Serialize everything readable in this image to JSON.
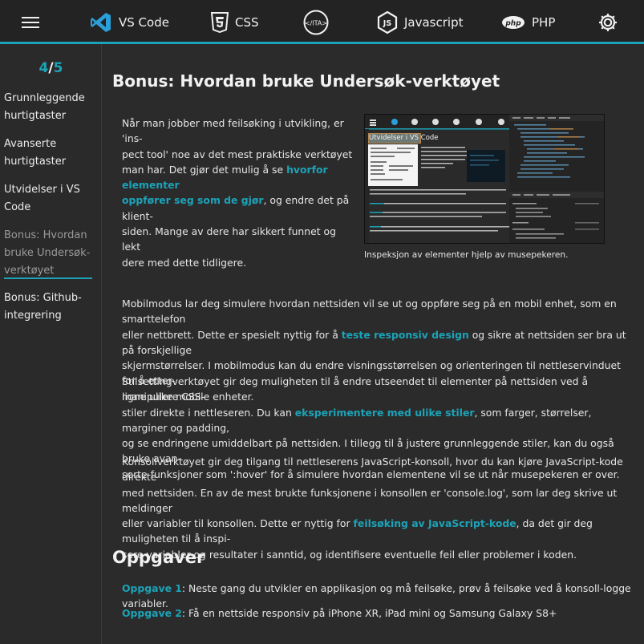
{
  "topnav": {
    "items": [
      {
        "label": "VS Code",
        "icon": "vscode-icon"
      },
      {
        "label": "CSS",
        "icon": "css3-icon"
      },
      {
        "label": "",
        "icon": "ita-logo-icon"
      },
      {
        "label": "Javascript",
        "icon": "js-icon"
      },
      {
        "label": "PHP",
        "icon": "php-icon"
      },
      {
        "label": "",
        "icon": "gear-icon"
      }
    ],
    "accent": "#1ca3b8"
  },
  "sidebar": {
    "progress": {
      "current": "4",
      "separator": "/",
      "total": "5"
    },
    "items": [
      {
        "line1": "Grunnleggende",
        "line2": "hurtigtaster"
      },
      {
        "line1": "Avanserte",
        "line2": "hurtigtaster"
      },
      {
        "line1": "Utvidelser i VS",
        "line2": "Code"
      },
      {
        "line1": "Bonus: Hvordan",
        "line2": "bruke Undersøk-",
        "line3": "verktøyet"
      },
      {
        "line1": "Bonus: Github-",
        "line2": "integrering"
      }
    ]
  },
  "main": {
    "heading": "Bonus: Hvordan bruke Undersøk-verktøyet",
    "intro": {
      "lines": [
        "Når man jobber med feilsøking i utvikling, er 'ins-",
        "pect tool' noe av det mest praktiske verktøyet",
        "man har. Det gjør det mulig å se",
        "oppfører seg som de gjør",
        ", og endre det på klient-",
        "siden. Mange av dere har sikkert funnet og lekt",
        "dere med dette tidligere."
      ],
      "link_part1": "hvorfor elementer",
      "link_part2": "oppfører seg som de gjør"
    },
    "image_caption": "Inspeksjon av elementer hjelp av musepekeren.",
    "screenshot": {
      "title": "Utvidelser i VS Code"
    },
    "p_mobile": {
      "a": "Mobilmodus lar deg simulere hvordan nettsiden vil se ut og oppføre seg på en mobil enhet, som en smarttelefon",
      "b": "eller nettbrett. Dette er spesielt nyttig for å ",
      "link": "teste responsiv design",
      "c": " og sikre at nettsiden ser bra ut på forskjellige",
      "d": "skjermstørrelser. I mobilmodus kan du endre visningsstørrelsen og orienteringen til nettleservinduet for å etter-",
      "e": "ligne ulike mobile enheter."
    },
    "p_style": {
      "a": "Stilsettingverktøyet gir deg muligheten til å endre utseendet til elementer på nettsiden ved å manipulere CSS-",
      "b": "stiler direkte i nettleseren. Du kan ",
      "link": "eksperimentere med ulike stiler",
      "c": ", som farger, størrelser, marginer og padding,",
      "d": "og se endringene umiddelbart på nettsiden. I tillegg til å justere grunnleggende stiler, kan du også bruke avan-",
      "e": "serte funksjoner som ':hover' for å simulere hvordan elementene vil se ut når musepekeren er over."
    },
    "p_console": {
      "a": "Konsollverktøyet gir deg tilgang til nettleserens JavaScript-konsoll, hvor du kan kjøre JavaScript-kode direkte",
      "b": "med nettsiden. En av de mest brukte funksjonene i konsollen er 'console.log', som lar deg skrive ut meldinger",
      "c": "eller variabler til konsollen. Dette er nyttig for ",
      "link": "feilsøking av JavaScript-kode",
      "d": ", da det gir deg muligheten til å inspi-",
      "e": "sere variabler og resultater i sanntid, og identifisere eventuelle feil eller problemer i koden."
    },
    "tasks_heading": "Oppgaver",
    "tasks": [
      {
        "link": "Oppgave 1",
        "text": ": Neste gang du utvikler en applikasjon og må feilsøke, prøv å feilsøke ved å konsoll-logge variabler."
      },
      {
        "link": "Oppgave 2",
        "text": ": Få en nettside responsiv på iPhone XR, iPad mini og Samsung Galaxy S8+"
      }
    ]
  }
}
